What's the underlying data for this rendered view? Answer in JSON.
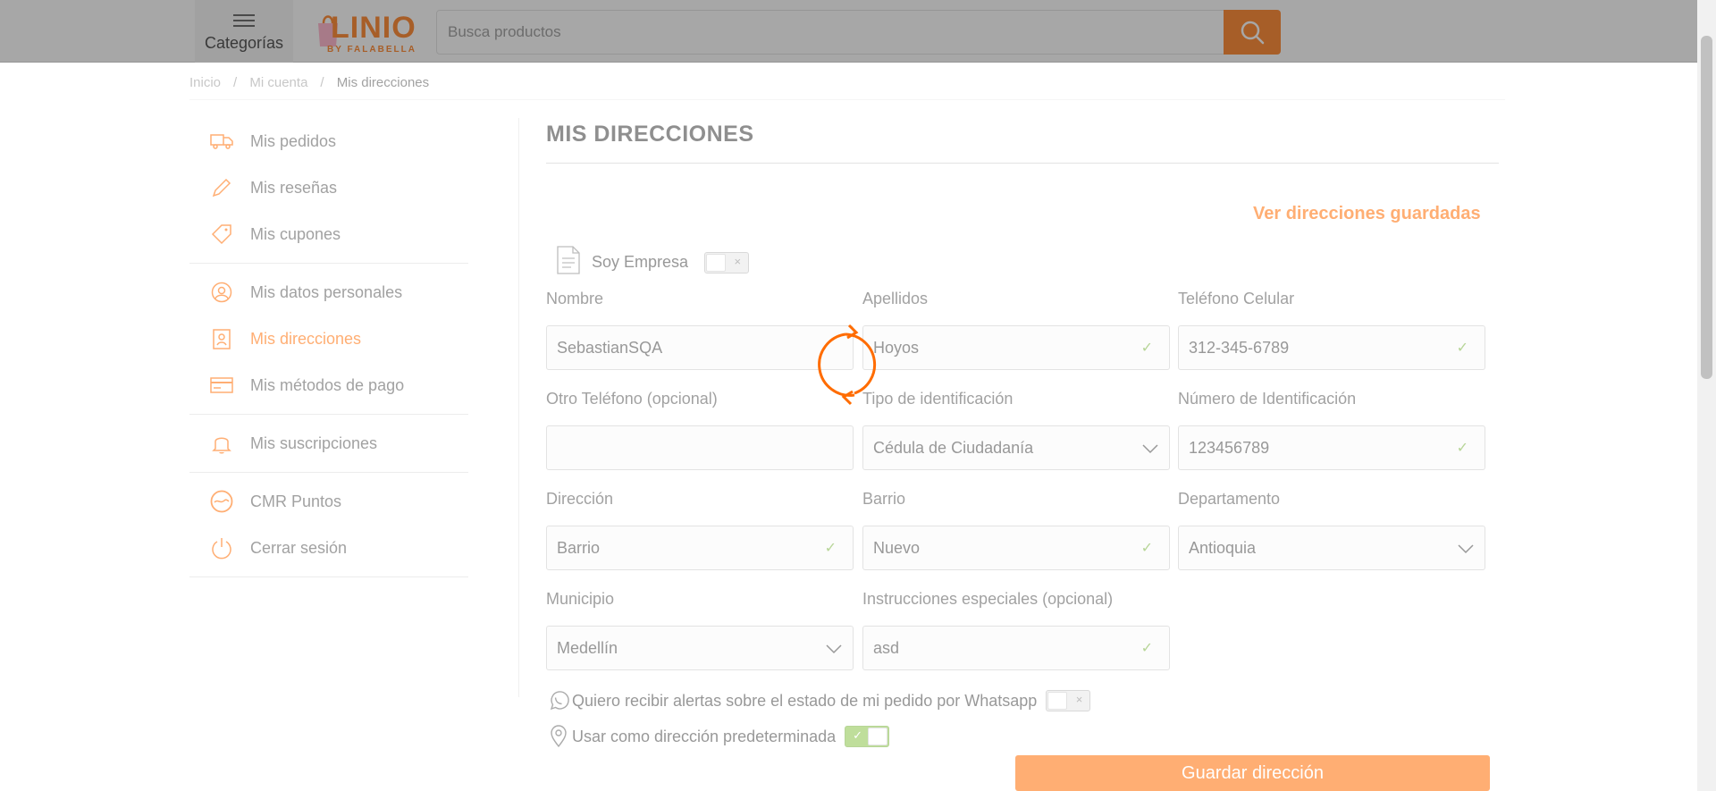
{
  "header": {
    "categories_label": "Categorías",
    "logo_text": "LINIO",
    "logo_sub": "BY FALABELLA",
    "search_placeholder": "Busca productos"
  },
  "breadcrumb": {
    "items": [
      "Inicio",
      "Mi cuenta",
      "Mis direcciones"
    ]
  },
  "sidebar": {
    "items": [
      {
        "label": "Mis pedidos",
        "icon": "truck-icon"
      },
      {
        "label": "Mis reseñas",
        "icon": "pencil-icon"
      },
      {
        "label": "Mis cupones",
        "icon": "tag-icon"
      },
      {
        "label": "Mis datos personales",
        "icon": "user-icon"
      },
      {
        "label": "Mis direcciones",
        "icon": "address-icon"
      },
      {
        "label": "Mis métodos de pago",
        "icon": "card-icon"
      },
      {
        "label": "Mis suscripciones",
        "icon": "bell-icon"
      },
      {
        "label": "CMR Puntos",
        "icon": "cmr-icon"
      },
      {
        "label": "Cerrar sesión",
        "icon": "power-icon"
      }
    ]
  },
  "main": {
    "title": "MIS DIRECCIONES",
    "saved_link": "Ver direcciones guardadas",
    "company_label": "Soy Empresa",
    "company_toggle_mark": "×",
    "fields": {
      "nombre": {
        "label": "Nombre",
        "value": "SebastianSQA"
      },
      "apellidos": {
        "label": "Apellidos",
        "value": "Hoyos"
      },
      "telefono": {
        "label": "Teléfono Celular",
        "value": "312-345-6789"
      },
      "otro_telefono": {
        "label": "Otro Teléfono (opcional)",
        "value": ""
      },
      "tipo_id": {
        "label": "Tipo de identificación",
        "value": "Cédula de Ciudadanía"
      },
      "numero_id": {
        "label": "Número de Identificación",
        "value": "123456789"
      },
      "direccion": {
        "label": "Dirección",
        "value": "Barrio"
      },
      "barrio": {
        "label": "Barrio",
        "value": "Nuevo"
      },
      "departamento": {
        "label": "Departamento",
        "value": "Antioquia"
      },
      "municipio": {
        "label": "Municipio",
        "value": "Medellín"
      },
      "instrucciones": {
        "label": "Instrucciones especiales (opcional)",
        "value": "asd"
      }
    },
    "check_mark": "✓",
    "whatsapp_label": "Quiero recibir alertas sobre el estado de mi pedido por Whatsapp",
    "whatsapp_toggle_mark": "×",
    "default_label": "Usar como dirección predeterminada",
    "default_toggle_mark": "✓",
    "save_button": "Guardar dirección"
  },
  "colors": {
    "accent": "#ff6c00",
    "success": "#7cb342"
  }
}
